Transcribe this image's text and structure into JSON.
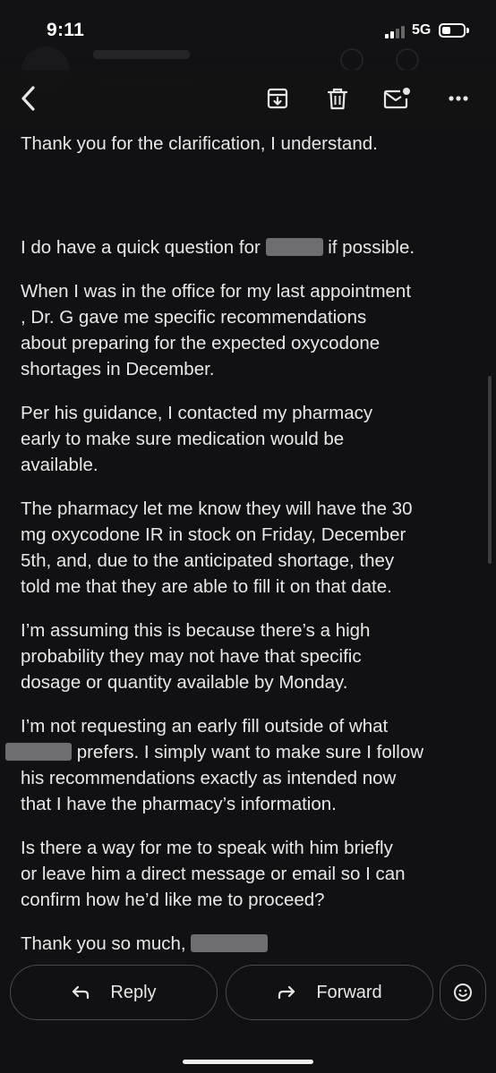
{
  "status_bar": {
    "time": "9:11",
    "network": "5G",
    "icons": [
      "cellular-signal-icon",
      "battery-icon"
    ]
  },
  "toolbar": {
    "icons": [
      "back-arrow-icon",
      "archive-icon",
      "trash-icon",
      "mark-unread-icon",
      "more-options-icon"
    ]
  },
  "message": {
    "paragraphs": [
      "Thank you for the clarification, I understand.",
      "I do have a quick question for",
      "if possible.",
      "When I was in the office for my last appointment\n, Dr. G gave me specific recommendations\nabout preparing for the expected oxycodone\nshortages in December.",
      " Per his guidance, I contacted my pharmacy\nearly to make sure medication would be\navailable.",
      "The pharmacy let me know they will have the 30\nmg oxycodone IR in stock on Friday, December\n5th, and,  due to the anticipated shortage,  they\ntold me that they are able to fill it on that date.",
      "I’m assuming this is because there’s a high\nprobability they may not have that specific\ndosage or quantity available by Monday.",
      "I’m not requesting an early fill outside of what",
      "prefers. I simply want to make sure I follow\nhis recommendations exactly as intended now\nthat I have the pharmacy’s information.",
      "Is there a way for me to speak with him briefly\nor leave him a direct message or email so I can\nconfirm how he’d like me to proceed?",
      "Thank you so much,"
    ]
  },
  "actions": {
    "reply_label": "Reply",
    "forward_label": "Forward",
    "icons": [
      "reply-icon",
      "forward-icon",
      "emoji-reaction-icon"
    ]
  },
  "colors": {
    "background": "#111113",
    "text": "#e8e8e8",
    "redaction": "#6e6e72",
    "pill_border": "#4a4a4e"
  }
}
